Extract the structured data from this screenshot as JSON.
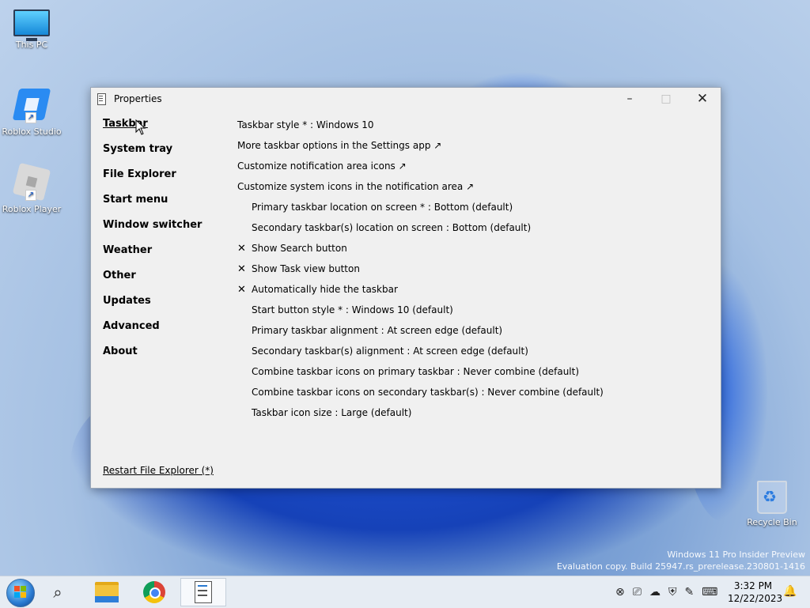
{
  "desktop": {
    "icons": [
      {
        "label": "This PC"
      },
      {
        "label": "Roblox Studio"
      },
      {
        "label": "Roblox Player"
      },
      {
        "label": "Recycle Bin"
      }
    ],
    "watermark": {
      "line1": "Windows 11 Pro Insider Preview",
      "line2": "Evaluation copy. Build 25947.rs_prerelease.230801-1416"
    }
  },
  "window": {
    "title": "Properties",
    "controls": {
      "minimize": "–",
      "maximize": "□",
      "close": "✕"
    },
    "sidebar": {
      "items": [
        {
          "label": "Taskbar",
          "active": true
        },
        {
          "label": "System tray"
        },
        {
          "label": "File Explorer"
        },
        {
          "label": "Start menu"
        },
        {
          "label": "Window switcher"
        },
        {
          "label": "Weather"
        },
        {
          "label": "Other"
        },
        {
          "label": "Updates"
        },
        {
          "label": "Advanced"
        },
        {
          "label": "About"
        }
      ],
      "restart_label": "Restart File Explorer (*)"
    },
    "settings": [
      {
        "text": "Taskbar style * : Windows 10"
      },
      {
        "text": "More taskbar options in the Settings app ↗"
      },
      {
        "text": "Customize notification area icons ↗"
      },
      {
        "text": "Customize system icons in the notification area ↗"
      },
      {
        "text": "Primary taskbar location on screen * : Bottom (default)"
      },
      {
        "text": "Secondary taskbar(s) location on screen : Bottom (default)"
      },
      {
        "text": "Show Search button",
        "mark": "✕"
      },
      {
        "text": "Show Task view button",
        "mark": "✕"
      },
      {
        "text": "Automatically hide the taskbar",
        "mark": "✕"
      },
      {
        "text": "Start button style * : Windows 10 (default)"
      },
      {
        "text": "Primary taskbar alignment : At screen edge (default)"
      },
      {
        "text": "Secondary taskbar(s) alignment : At screen edge (default)"
      },
      {
        "text": "Combine taskbar icons on primary taskbar : Never combine (default)"
      },
      {
        "text": "Combine taskbar icons on secondary taskbar(s) : Never combine (default)"
      },
      {
        "text": "Taskbar icon size : Large (default)"
      }
    ]
  },
  "taskbar": {
    "search_glyph": "⌕",
    "tray_icons": {
      "bluetooth": "⊗",
      "network": "⎚",
      "onedrive": "☁",
      "security": "⛨",
      "pen": "✎",
      "keyboard": "⌨"
    },
    "clock": {
      "time": "3:32 PM",
      "date": "12/22/2023"
    },
    "bell_glyph": "🔔"
  }
}
